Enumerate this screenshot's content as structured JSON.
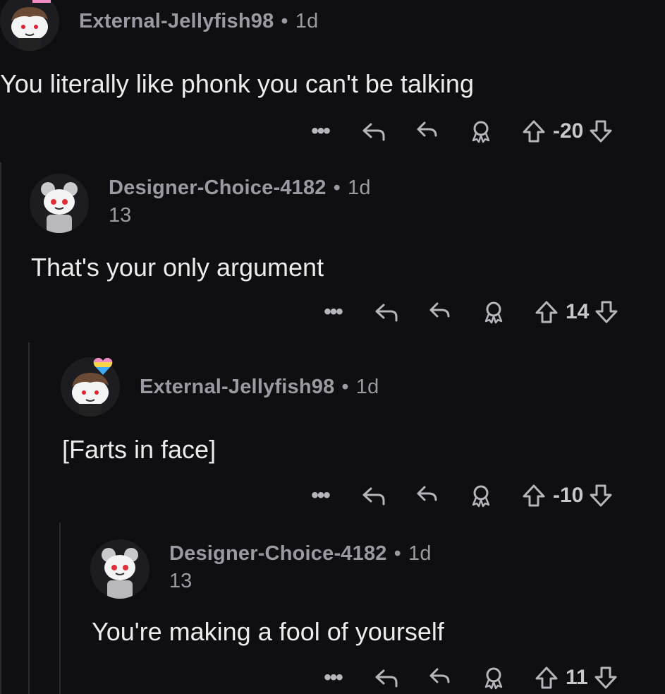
{
  "comments": [
    {
      "username": "External-Jellyfish98",
      "separator": "•",
      "age": "1d",
      "flair": "",
      "body": "You literally like phonk you can't be talking",
      "more": "•••",
      "score": "-20"
    },
    {
      "username": "Designer-Choice-4182",
      "separator": "•",
      "age": "1d",
      "flair": "13",
      "body": "That's your only argument",
      "more": "•••",
      "score": "14"
    },
    {
      "username": "External-Jellyfish98",
      "separator": "•",
      "age": "1d",
      "flair": "",
      "body": "[Farts in face]",
      "more": "•••",
      "score": "-10"
    },
    {
      "username": "Designer-Choice-4182",
      "separator": "•",
      "age": "1d",
      "flair": "13",
      "body": "You're making a fool of yourself",
      "more": "•••",
      "score": "11"
    }
  ],
  "icons": {
    "more": "ellipsis-icon",
    "reply": "reply-icon",
    "share": "share-icon",
    "award": "award-icon",
    "upvote": "upvote-arrow-icon",
    "downvote": "downvote-arrow-icon"
  },
  "colors": {
    "background": "#0f0f12",
    "meta_text": "#9a9aa2",
    "body_text": "#ececec",
    "icon": "#b5b5bb",
    "thread_line": "#2a2a2e"
  }
}
